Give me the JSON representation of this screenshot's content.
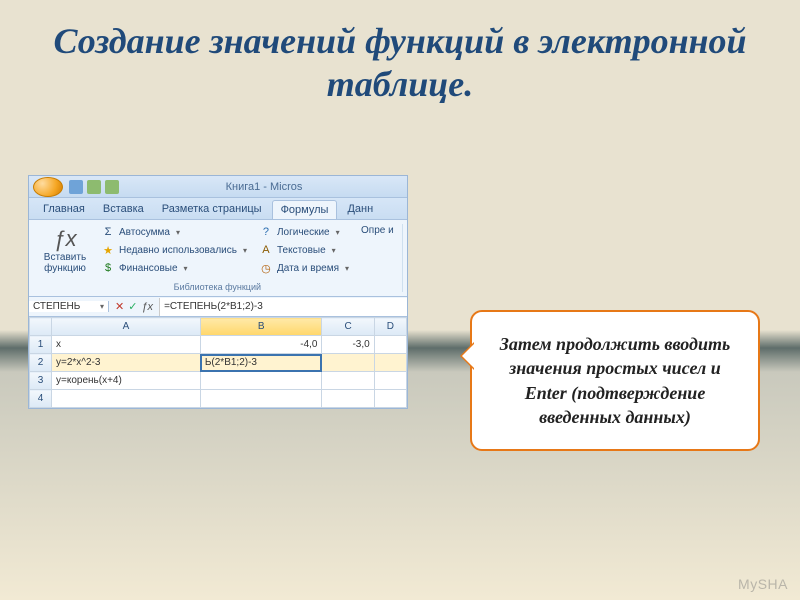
{
  "slide": {
    "title": "Создание значений функций в электронной таблице."
  },
  "window": {
    "title": "Книга1 - Micros"
  },
  "tabs": {
    "home": "Главная",
    "insert": "Вставка",
    "page_layout": "Разметка страницы",
    "formulas": "Формулы",
    "data": "Данн"
  },
  "ribbon": {
    "insert_fn": "Вставить функцию",
    "autosum": "Автосумма",
    "recent": "Недавно использовались",
    "financial": "Финансовые",
    "logical": "Логические",
    "text": "Текстовые",
    "datetime": "Дата и время",
    "more": "Опре и",
    "group_label": "Библиотека функций"
  },
  "formula_bar": {
    "name_box": "СТЕПЕНЬ",
    "formula": "=СТЕПЕНЬ(2*B1;2)-3"
  },
  "sheet": {
    "cols": [
      "A",
      "B",
      "C",
      "D"
    ],
    "rows": [
      {
        "n": "1",
        "A": "x",
        "B": "-4,0",
        "C": "-3,0",
        "D": ""
      },
      {
        "n": "2",
        "A": "y=2*x^2-3",
        "B": "Ь(2*B1;2)-3",
        "C": "",
        "D": ""
      },
      {
        "n": "3",
        "A": "y=корень(x+4)",
        "B": "",
        "C": "",
        "D": ""
      },
      {
        "n": "4",
        "A": "",
        "B": "",
        "C": "",
        "D": ""
      }
    ]
  },
  "callout": {
    "text": "Затем продолжить вводить значения простых чисел и Enter (подтверждение введенных данных)"
  },
  "watermark": "MySHA"
}
